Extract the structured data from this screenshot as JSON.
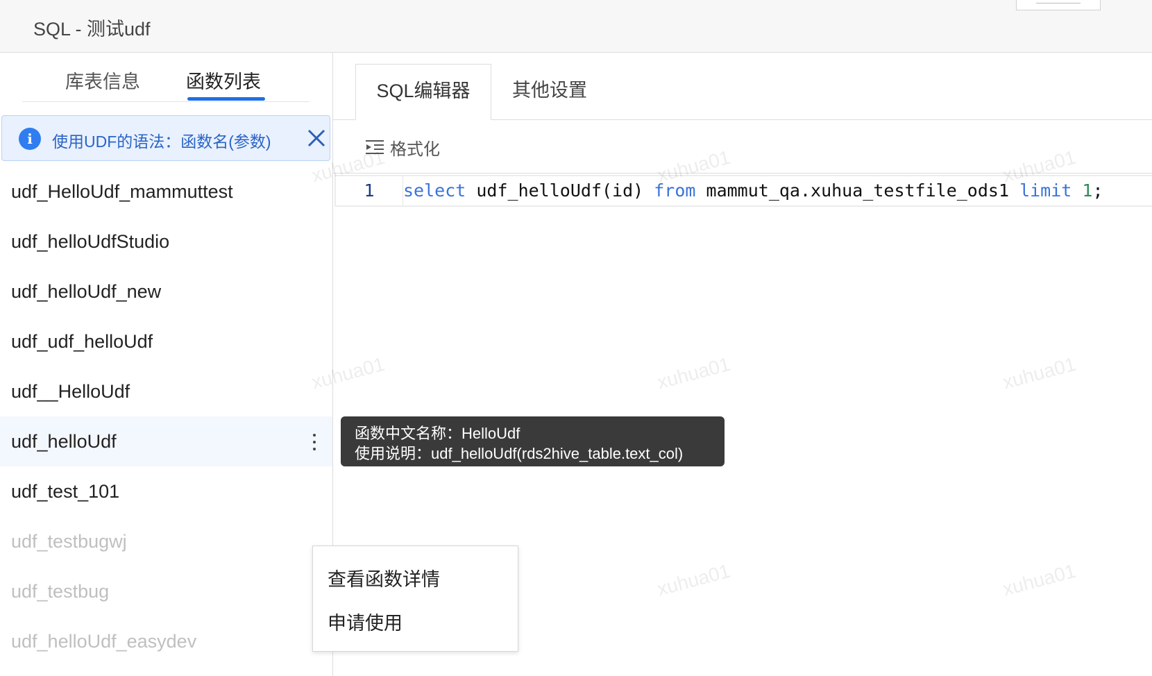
{
  "header": {
    "title": "SQL - 测试udf"
  },
  "left_panel": {
    "tabs": [
      {
        "label": "库表信息",
        "active": false
      },
      {
        "label": "函数列表",
        "active": true
      }
    ],
    "alert": {
      "text": "使用UDF的语法：函数名(参数)"
    },
    "functions": [
      {
        "name": "udf_HelloUdf_mammuttest",
        "state": "normal"
      },
      {
        "name": "udf_helloUdfStudio",
        "state": "normal"
      },
      {
        "name": "udf_helloUdf_new",
        "state": "normal"
      },
      {
        "name": "udf_udf_helloUdf",
        "state": "normal"
      },
      {
        "name": "udf__HelloUdf",
        "state": "normal"
      },
      {
        "name": "udf_helloUdf",
        "state": "selected"
      },
      {
        "name": "udf_test_101",
        "state": "normal"
      },
      {
        "name": "udf_testbugwj",
        "state": "muted"
      },
      {
        "name": "udf_testbug",
        "state": "muted"
      },
      {
        "name": "udf_helloUdf_easydev",
        "state": "muted"
      }
    ]
  },
  "right_panel": {
    "tabs": [
      {
        "label": "SQL编辑器",
        "active": true
      },
      {
        "label": "其他设置",
        "active": false
      }
    ],
    "toolbar": {
      "format_label": "格式化"
    },
    "editor": {
      "line_number": "1",
      "tokens": {
        "select": "select",
        "fn": " udf_helloUdf(id) ",
        "from": "from",
        "table": " mammut_qa.xuhua_testfile_ods1 ",
        "limit": "limit",
        "space": " ",
        "num": "1",
        "semi": ";"
      }
    }
  },
  "tooltip": {
    "line1": "函数中文名称：HelloUdf",
    "line2": "使用说明：udf_helloUdf(rds2hive_table.text_col)"
  },
  "context_menu": {
    "items": [
      "查看函数详情",
      "申请使用"
    ]
  },
  "watermark": {
    "text": "xuhua01"
  },
  "colors": {
    "accent": "#1e6fe3",
    "alert_bg": "#e8f1fd",
    "keyword": "#3b73d9",
    "number": "#2e8b57",
    "tooltip_bg": "#3a3a3a"
  }
}
